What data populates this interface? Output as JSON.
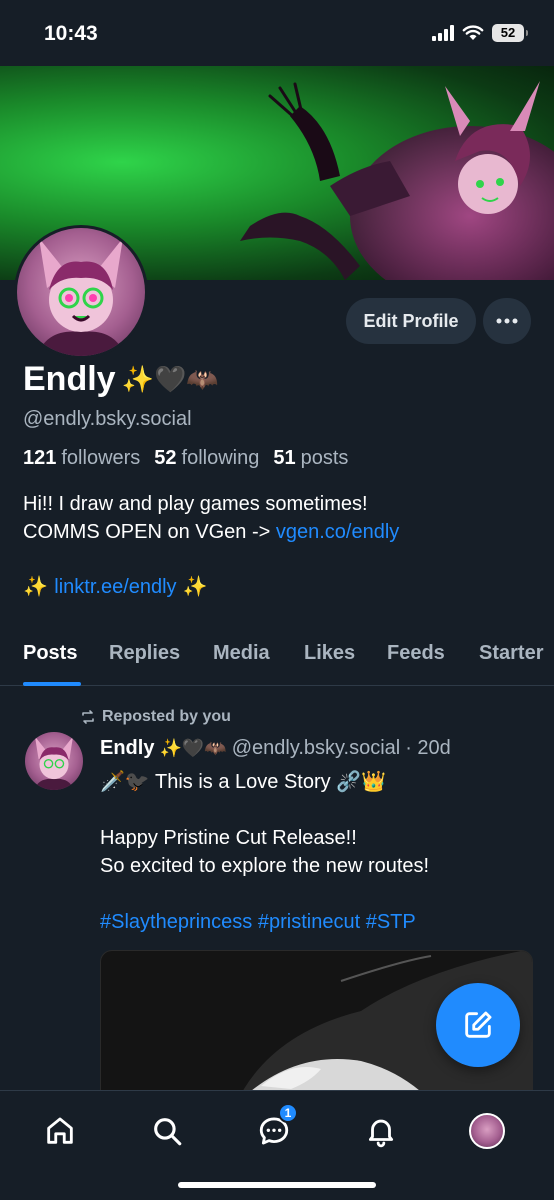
{
  "status_bar": {
    "time": "10:43",
    "battery": "52"
  },
  "profile": {
    "display_name": "Endly",
    "name_emojis": "✨🖤🦇",
    "handle": "@endly.bsky.social",
    "followers_count": "121",
    "followers_label": "followers",
    "following_count": "52",
    "following_label": "following",
    "posts_count": "51",
    "posts_label": "posts",
    "bio_line1": "Hi!! I draw and play games sometimes!",
    "bio_line2_text": "COMMS OPEN on VGen -> ",
    "bio_line2_link": "vgen.co/endly",
    "bio_links_prefix": "✨ ",
    "bio_links_link": "linktr.ee/endly",
    "bio_links_suffix": " ✨",
    "edit_button": "Edit Profile"
  },
  "tabs": [
    "Posts",
    "Replies",
    "Media",
    "Likes",
    "Feeds",
    "Starter"
  ],
  "post": {
    "repost_label": "Reposted by you",
    "author_name": "Endly",
    "author_emojis": "✨🖤🦇",
    "author_handle": "@endly.bsky.social",
    "time": "· 20d",
    "line1": "🗡️🐦‍⬛ This is a Love Story ⛓️‍💥👑",
    "line2": "Happy Pristine Cut Release!!",
    "line3": "So excited to explore the new routes!",
    "hashtags": "#Slaytheprincess #pristinecut #STP"
  },
  "bottom_nav": {
    "chat_badge": "1"
  },
  "colors": {
    "accent": "#208bfe",
    "background": "#161e27",
    "button_bg": "#26323f"
  }
}
